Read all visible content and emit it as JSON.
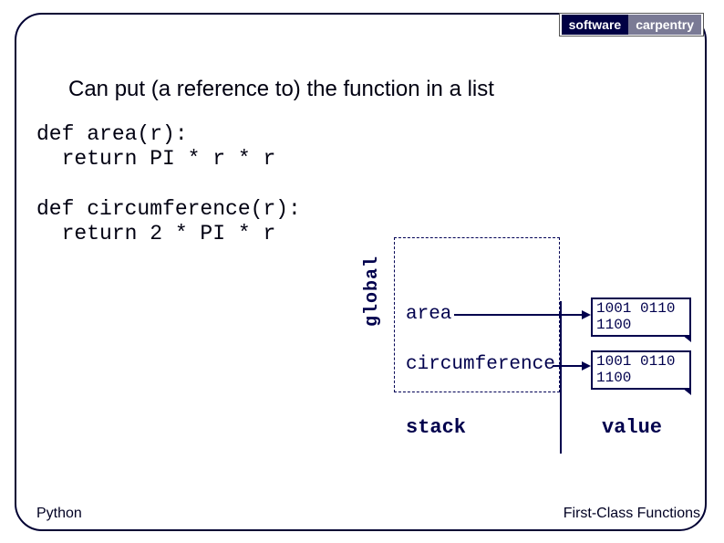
{
  "logo": {
    "left": "software",
    "right": "carpentry"
  },
  "title": "Can put (a reference to) the function in a list",
  "code": {
    "block1": "def area(r):\n  return PI * r * r",
    "block2": "def circumference(r):\n  return 2 * PI * r"
  },
  "diagram": {
    "global_label": "global",
    "entry1": "area",
    "entry2": "circumference",
    "bin1": "1001 0110\n1100",
    "bin2": "1001 0110\n1100",
    "stack_label": "stack",
    "value_label": "value"
  },
  "footer": {
    "left": "Python",
    "right": "First-Class Functions"
  }
}
